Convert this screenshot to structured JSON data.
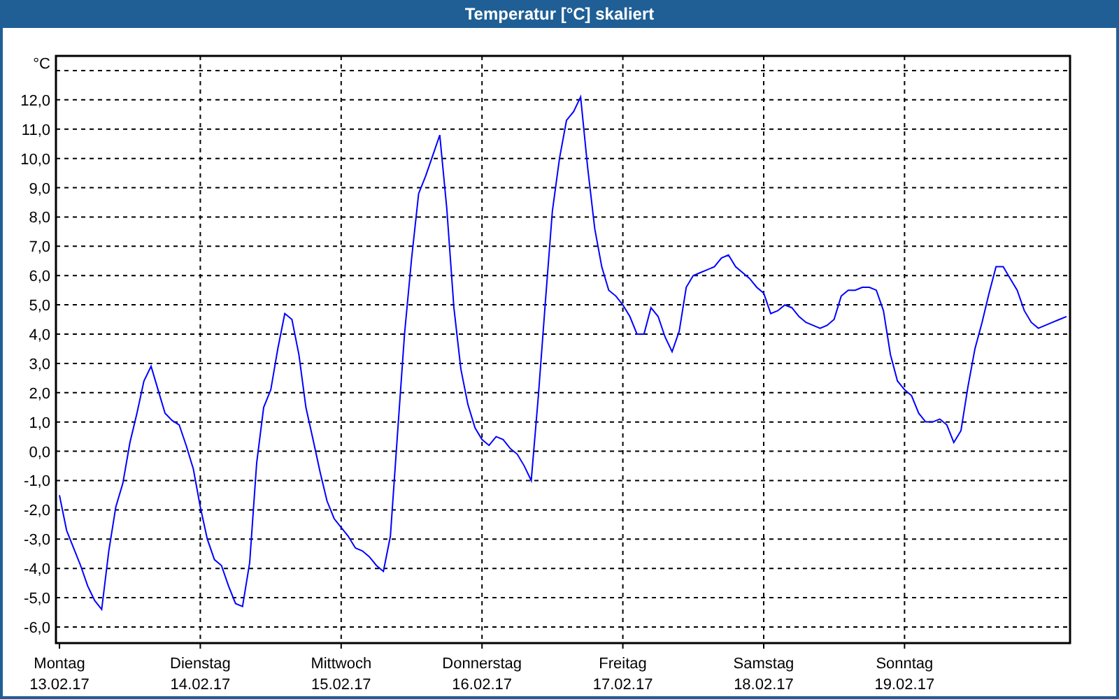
{
  "window": {
    "title": "Temperatur [°C] skaliert"
  },
  "chart": {
    "chart_data": {
      "type": "line",
      "ylabel": "°C",
      "ylim": [
        -6.55,
        13.5
      ],
      "grid": true,
      "yticks": [
        {
          "value": -6,
          "label": "-6,0"
        },
        {
          "value": -5,
          "label": "-5,0"
        },
        {
          "value": -4,
          "label": "-4,0"
        },
        {
          "value": -3,
          "label": "-3,0"
        },
        {
          "value": -2,
          "label": "-2,0"
        },
        {
          "value": -1,
          "label": "-1,0"
        },
        {
          "value": 0,
          "label": "0,0"
        },
        {
          "value": 1,
          "label": "1,0"
        },
        {
          "value": 2,
          "label": "2,0"
        },
        {
          "value": 3,
          "label": "3,0"
        },
        {
          "value": 4,
          "label": "4,0"
        },
        {
          "value": 5,
          "label": "5,0"
        },
        {
          "value": 6,
          "label": "6,0"
        },
        {
          "value": 7,
          "label": "7,0"
        },
        {
          "value": 8,
          "label": "8,0"
        },
        {
          "value": 9,
          "label": "9,0"
        },
        {
          "value": 10,
          "label": "10,0"
        },
        {
          "value": 11,
          "label": "11,0"
        },
        {
          "value": 12,
          "label": "12,0"
        }
      ],
      "categories": [
        "Montag\n13.02.17",
        null,
        null,
        null,
        null,
        null,
        null,
        null,
        null,
        null,
        null,
        null,
        null,
        null,
        null,
        null,
        null,
        null,
        null,
        null,
        "Dienstag\n14.02.17",
        null,
        null,
        null,
        null,
        null,
        null,
        null,
        null,
        null,
        null,
        null,
        null,
        null,
        null,
        null,
        null,
        null,
        null,
        null,
        "Mittwoch\n15.02.17",
        null,
        null,
        null,
        null,
        null,
        null,
        null,
        null,
        null,
        null,
        null,
        null,
        null,
        null,
        null,
        null,
        null,
        null,
        null,
        "Donnerstag\n16.02.17",
        null,
        null,
        null,
        null,
        null,
        null,
        null,
        null,
        null,
        null,
        null,
        null,
        null,
        null,
        null,
        null,
        null,
        null,
        null,
        "Freitag\n17.02.17",
        null,
        null,
        null,
        null,
        null,
        null,
        null,
        null,
        null,
        null,
        null,
        null,
        null,
        null,
        null,
        null,
        null,
        null,
        null,
        "Samstag\n18.02.17",
        null,
        null,
        null,
        null,
        null,
        null,
        null,
        null,
        null,
        null,
        null,
        null,
        null,
        null,
        null,
        null,
        null,
        null,
        null,
        "Sonntag\n19.02.17",
        null,
        null,
        null,
        null,
        null,
        null,
        null,
        null,
        null,
        null,
        null,
        null,
        null,
        null,
        null,
        null,
        null,
        null,
        null,
        null,
        null,
        null,
        null
      ],
      "series": [
        {
          "color": "#0000ff",
          "values": [
            -1.5,
            -2.7,
            -3.3,
            -3.9,
            -4.6,
            -5.1,
            -5.4,
            -3.4,
            -1.9,
            -1.1,
            0.3,
            1.3,
            2.4,
            2.9,
            2.1,
            1.3,
            1.05,
            0.9,
            0.2,
            -0.6,
            -1.9,
            -3.0,
            -3.7,
            -3.9,
            -4.6,
            -5.2,
            -5.3,
            -3.8,
            -0.4,
            1.5,
            2.1,
            3.5,
            4.7,
            4.5,
            3.3,
            1.5,
            0.4,
            -0.7,
            -1.7,
            -2.3,
            -2.6,
            -2.9,
            -3.3,
            -3.4,
            -3.6,
            -3.9,
            -4.1,
            -2.9,
            0.6,
            4.0,
            6.6,
            8.8,
            9.4,
            10.1,
            10.8,
            8.3,
            4.9,
            2.8,
            1.6,
            0.8,
            0.4,
            0.2,
            0.5,
            0.4,
            0.1,
            -0.1,
            -0.5,
            -1.0,
            1.9,
            5.1,
            8.2,
            10.0,
            11.3,
            11.6,
            12.1,
            9.7,
            7.6,
            6.3,
            5.5,
            5.3,
            5.0,
            4.6,
            4.0,
            4.0,
            4.9,
            4.6,
            3.9,
            3.4,
            4.1,
            5.6,
            6.0,
            6.1,
            6.2,
            6.3,
            6.6,
            6.7,
            6.3,
            6.1,
            5.9,
            5.6,
            5.4,
            4.7,
            4.8,
            5.0,
            4.9,
            4.6,
            4.4,
            4.3,
            4.2,
            4.3,
            4.5,
            5.3,
            5.5,
            5.5,
            5.6,
            5.6,
            5.5,
            4.8,
            3.3,
            2.4,
            2.1,
            1.9,
            1.3,
            1.0,
            1.0,
            1.1,
            0.9,
            0.3,
            0.7,
            2.2,
            3.5,
            4.4,
            5.4,
            6.3,
            6.3,
            5.9,
            5.5,
            4.8,
            4.4,
            4.2,
            4.3,
            4.4,
            4.5,
            4.6
          ]
        }
      ]
    }
  }
}
